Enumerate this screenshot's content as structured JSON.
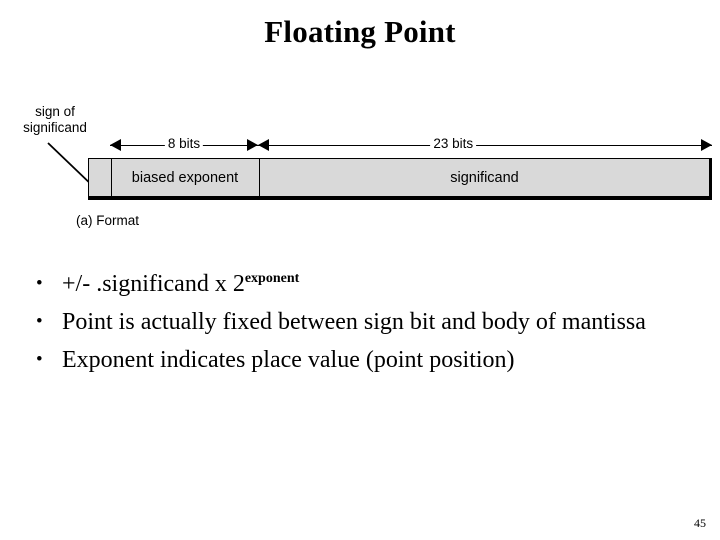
{
  "slide": {
    "title": "Floating Point",
    "page_number": "45"
  },
  "figure": {
    "sign_callout": "sign of\nsignificand",
    "sign_callout_line1": "sign of",
    "sign_callout_line2": "significand",
    "caption": "(a) Format",
    "measures": [
      {
        "label": "8 bits"
      },
      {
        "label": "23 bits"
      }
    ],
    "fields": [
      {
        "name": "sign",
        "label": ""
      },
      {
        "name": "biased-exponent",
        "label": "biased exponent"
      },
      {
        "name": "significand",
        "label": "significand"
      }
    ],
    "colors": {
      "field_fill": "#d9d9d9",
      "outline": "#000000"
    }
  },
  "bullets": [
    {
      "text": "+/- .significand x 2",
      "superscript": "exponent"
    },
    {
      "text": "Point is actually fixed between sign bit and body of mantissa",
      "superscript": ""
    },
    {
      "text": "Exponent indicates place value (point position)",
      "superscript": ""
    }
  ]
}
